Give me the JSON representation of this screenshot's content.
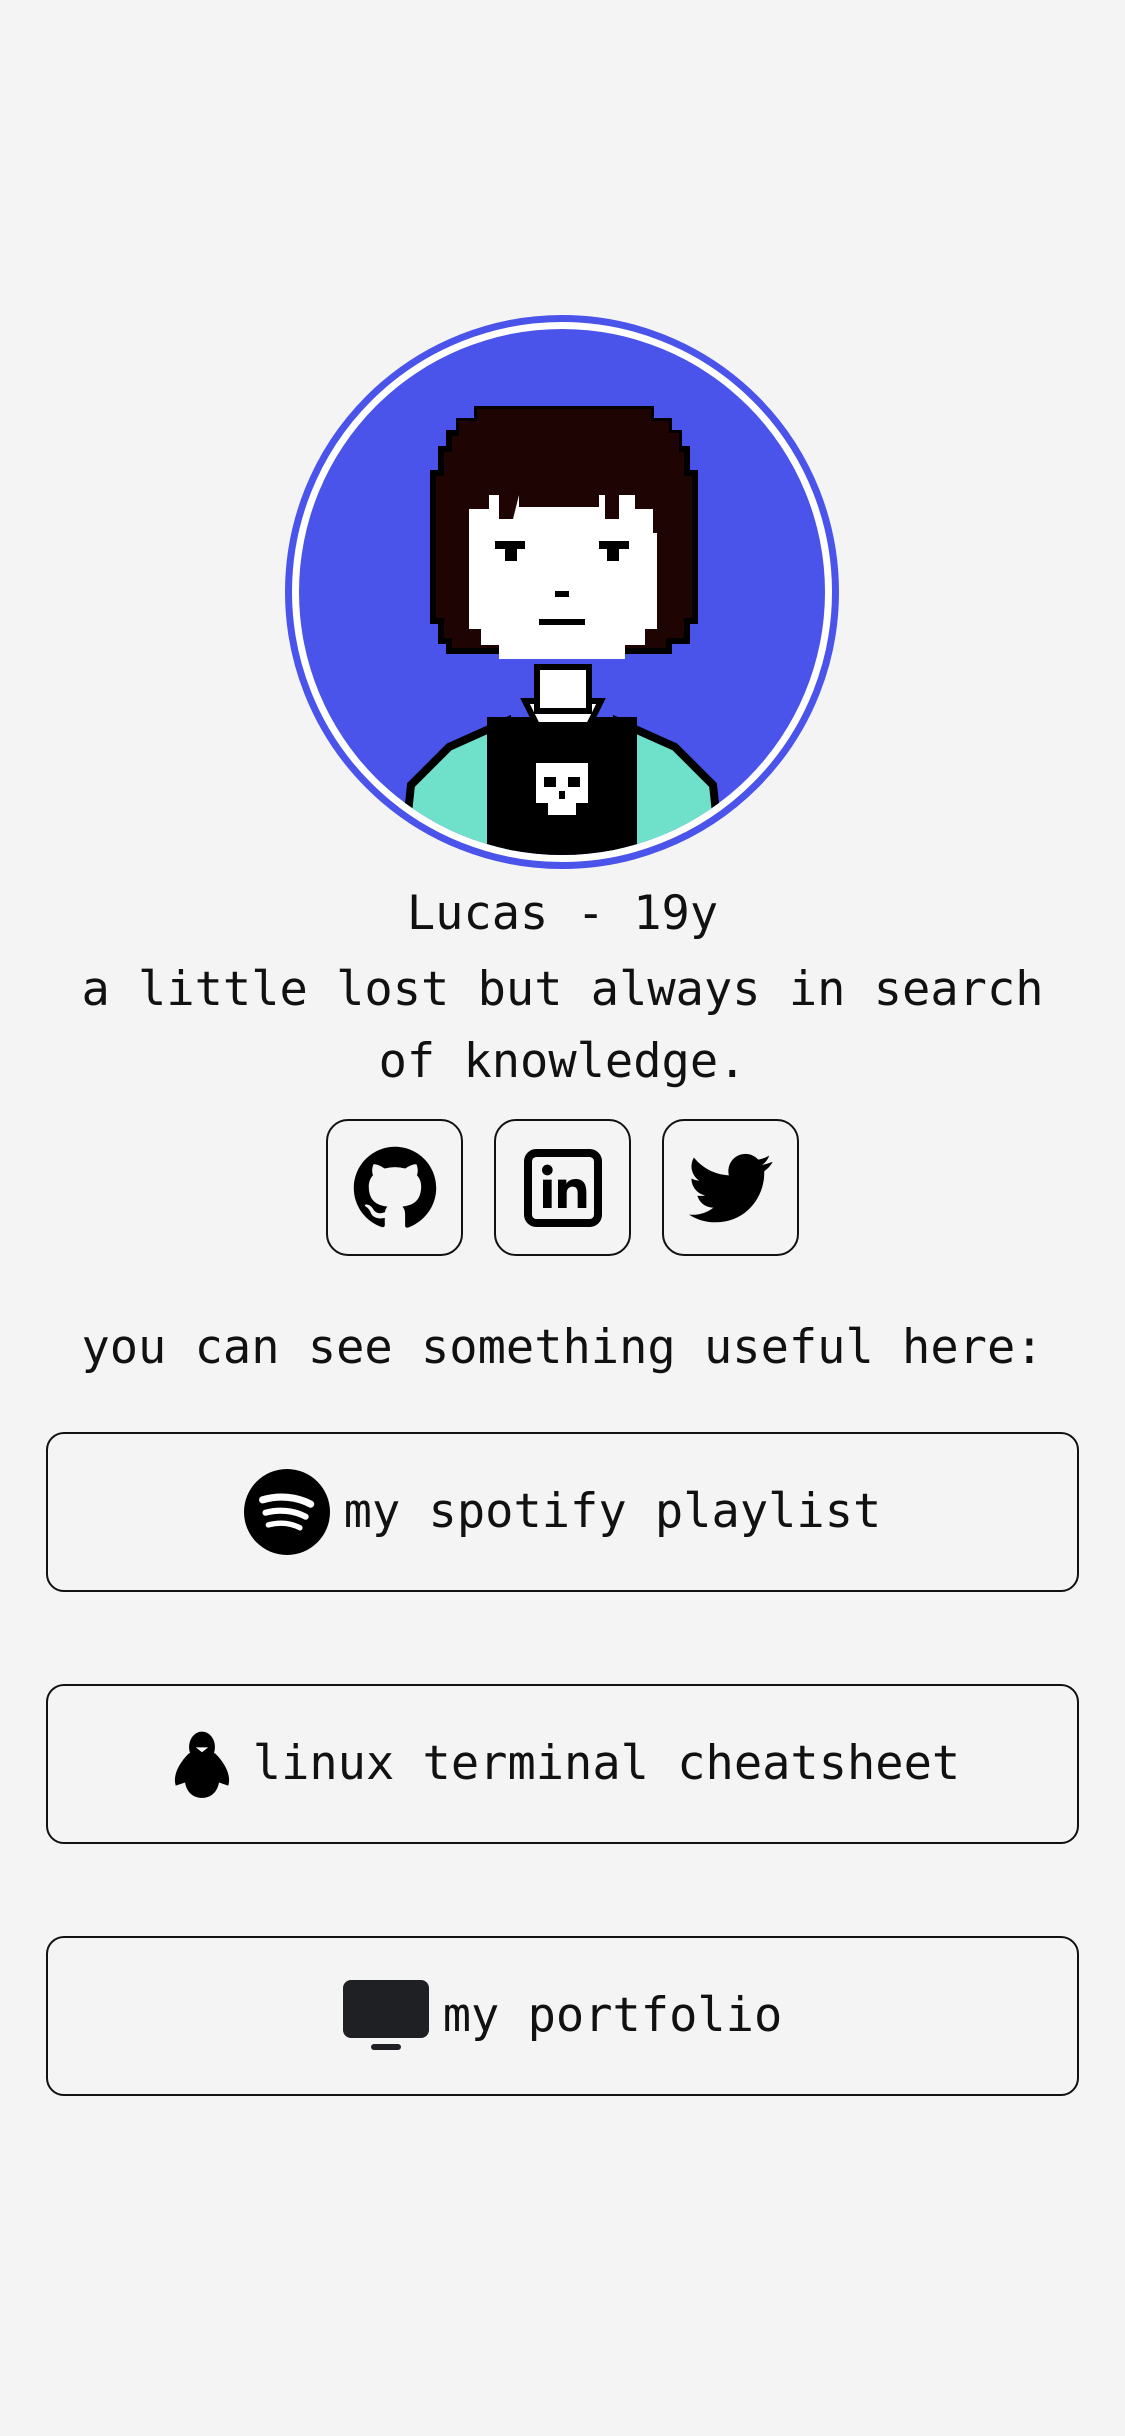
{
  "profile": {
    "name": "Lucas - 19y",
    "bio": "a little lost but always in search of knowledge.",
    "avatar_icon": "pixel-art-avatar",
    "accent_color": "#4a53ea"
  },
  "socials": [
    {
      "name": "github",
      "icon": "github-icon"
    },
    {
      "name": "linkedin",
      "icon": "linkedin-icon"
    },
    {
      "name": "twitter",
      "icon": "twitter-icon"
    }
  ],
  "section": {
    "label": "you can see something useful here:"
  },
  "links": [
    {
      "label": "my spotify playlist",
      "icon": "spotify-icon"
    },
    {
      "label": "linux terminal cheatsheet",
      "icon": "linux-tux-icon"
    },
    {
      "label": "my portfolio",
      "icon": "monitor-icon"
    }
  ]
}
